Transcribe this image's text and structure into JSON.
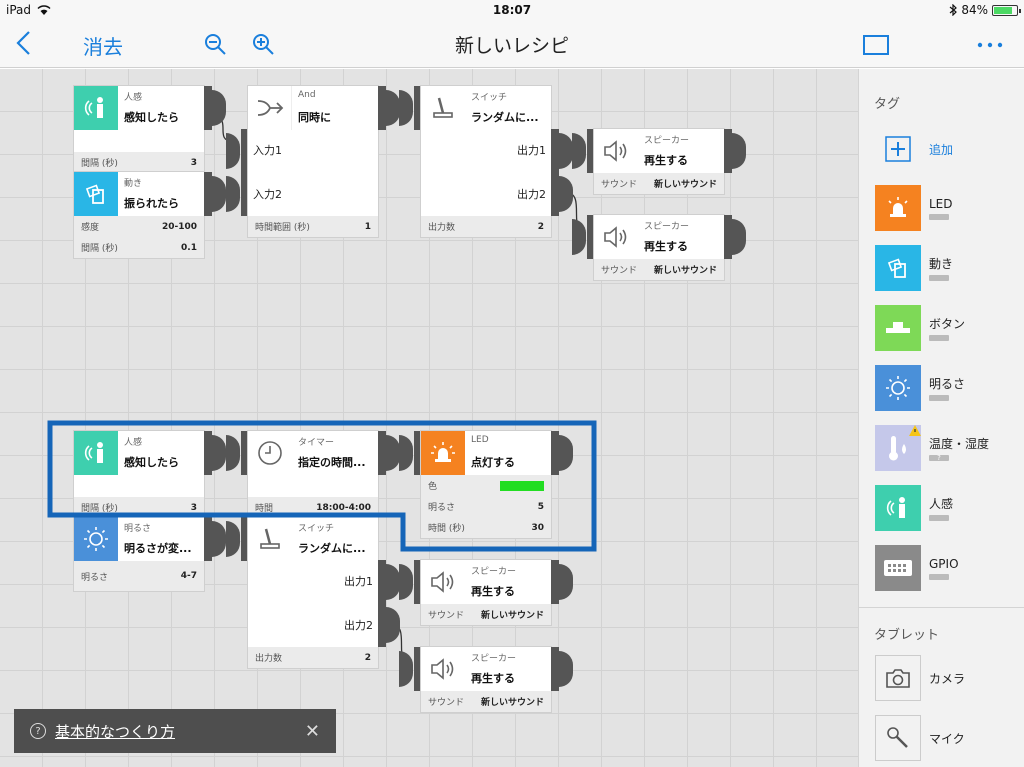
{
  "status": {
    "device": "iPad",
    "time": "18:07",
    "battery": "84%",
    "battery_level": 0.84
  },
  "nav": {
    "back_icon": "chevron-left-icon",
    "clear_label": "消去",
    "title": "新しいレシピ"
  },
  "blocks": {
    "human1": {
      "type": "人感",
      "title": "感知したら",
      "params": [
        {
          "label": "間隔 (秒)",
          "value": "3"
        }
      ]
    },
    "motion": {
      "type": "動き",
      "title": "振られたら",
      "params": [
        {
          "label": "感度",
          "value": "20-100"
        },
        {
          "label": "間隔 (秒)",
          "value": "0.1"
        }
      ]
    },
    "and": {
      "type": "And",
      "title": "同時に",
      "ports": [
        "入力1",
        "入力2"
      ],
      "params": [
        {
          "label": "時間範囲 (秒)",
          "value": "1"
        }
      ]
    },
    "switch1": {
      "type": "スイッチ",
      "title": "ランダムに...",
      "ports": [
        "出力1",
        "出力2"
      ],
      "params": [
        {
          "label": "出力数",
          "value": "2"
        }
      ]
    },
    "speaker1": {
      "type": "スピーカー",
      "title": "再生する",
      "params": [
        {
          "label": "サウンド",
          "value": "新しいサウンド"
        }
      ]
    },
    "speaker2": {
      "type": "スピーカー",
      "title": "再生する",
      "params": [
        {
          "label": "サウンド",
          "value": "新しいサウンド"
        }
      ]
    },
    "human2": {
      "type": "人感",
      "title": "感知したら",
      "params": [
        {
          "label": "間隔 (秒)",
          "value": "3"
        }
      ]
    },
    "timer": {
      "type": "タイマー",
      "title": "指定の時間...",
      "params": [
        {
          "label": "時間",
          "value": "18:00-4:00"
        }
      ]
    },
    "led": {
      "type": "LED",
      "title": "点灯する",
      "color_label": "色",
      "color": "#22dd22",
      "params": [
        {
          "label": "明るさ",
          "value": "5"
        },
        {
          "label": "時間 (秒)",
          "value": "30"
        }
      ]
    },
    "brightness": {
      "type": "明るさ",
      "title": "明るさが変...",
      "params": [
        {
          "label": "明るさ",
          "value": "4-7"
        }
      ]
    },
    "switch2": {
      "type": "スイッチ",
      "title": "ランダムに...",
      "ports": [
        "出力1",
        "出力2"
      ],
      "params": [
        {
          "label": "出力数",
          "value": "2"
        }
      ]
    },
    "speaker3": {
      "type": "スピーカー",
      "title": "再生する",
      "params": [
        {
          "label": "サウンド",
          "value": "新しいサウンド"
        }
      ]
    },
    "speaker4": {
      "type": "スピーカー",
      "title": "再生する",
      "params": [
        {
          "label": "サウンド",
          "value": "新しいサウンド"
        }
      ]
    }
  },
  "help": {
    "text": "基本的なつくり方"
  },
  "sidebar": {
    "tags_header": "タグ",
    "add_label": "追加",
    "tags": [
      {
        "name": "LED",
        "color": "#f58220"
      },
      {
        "name": "動き",
        "color": "#29b6e6"
      },
      {
        "name": "ボタン",
        "color": "#7ed957"
      },
      {
        "name": "明るさ",
        "color": "#4a90d9"
      },
      {
        "name": "温度・湿度",
        "color": "#c5c8ea",
        "badge": "?"
      },
      {
        "name": "人感",
        "color": "#3ecfae"
      },
      {
        "name": "GPIO",
        "color": "#8a8a8a"
      }
    ],
    "tablet_header": "タブレット",
    "tablet": [
      {
        "name": "カメラ"
      },
      {
        "name": "マイク"
      }
    ]
  },
  "colors": {
    "accent": "#1a7fdc",
    "selection": "#1565b8",
    "human": "#3ecfae",
    "motion": "#29b6e6",
    "led": "#f58220",
    "brightness": "#4a90d9"
  }
}
